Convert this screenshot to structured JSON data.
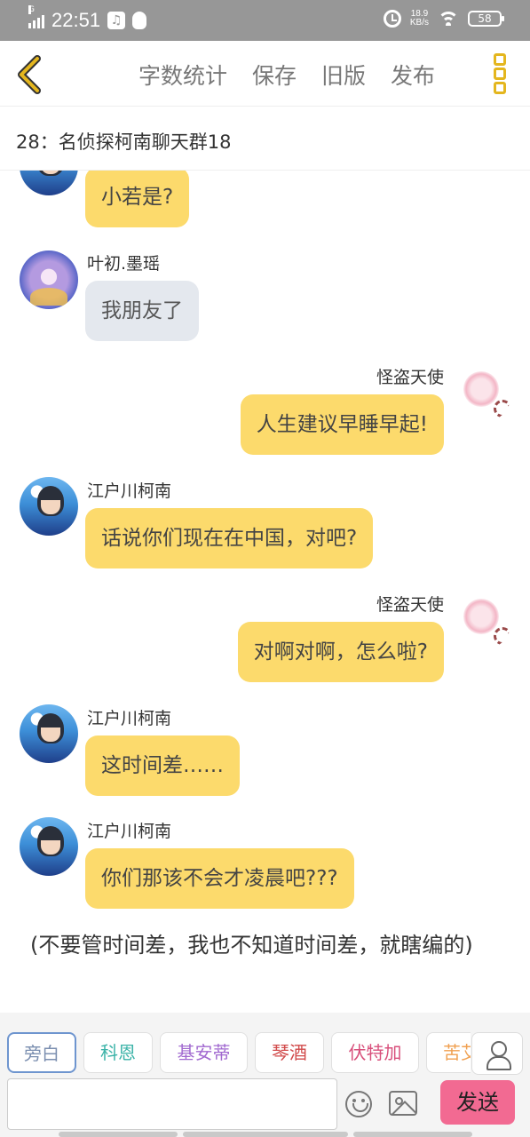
{
  "status_bar": {
    "network_type": "G",
    "time": "22:51",
    "speed_value": "18.9",
    "speed_unit": "KB/s",
    "battery": "58"
  },
  "toolbar": {
    "actions": [
      "字数统计",
      "保存",
      "旧版",
      "发布"
    ]
  },
  "chat_title": "28：名侦探柯南聊天群18",
  "messages": [
    {
      "side": "left",
      "name": "",
      "avatar": "conan-avatar",
      "text": "小若是?",
      "color": "yellow"
    },
    {
      "side": "left",
      "name": "叶初.墨瑶",
      "avatar": "ye-avatar",
      "text": "我朋友了",
      "color": "grey"
    },
    {
      "side": "right",
      "name": "怪盗天使",
      "avatar": "kid-avatar",
      "text": "人生建议早睡早起!",
      "color": "yellow"
    },
    {
      "side": "left",
      "name": "江户川柯南",
      "avatar": "conan-avatar",
      "text": "话说你们现在在中国，对吧?",
      "color": "yellow"
    },
    {
      "side": "right",
      "name": "怪盗天使",
      "avatar": "kid-avatar",
      "text": "对啊对啊，怎么啦?",
      "color": "yellow"
    },
    {
      "side": "left",
      "name": "江户川柯南",
      "avatar": "conan-avatar",
      "text": "这时间差……",
      "color": "yellow"
    },
    {
      "side": "left",
      "name": "江户川柯南",
      "avatar": "conan-avatar",
      "text": "你们那该不会才凌晨吧???",
      "color": "yellow"
    }
  ],
  "narration": "(不要管时间差，我也不知道时间差，就瞎编的)",
  "roles": [
    {
      "label": "旁白",
      "color": "#7b8fb0"
    },
    {
      "label": "科恩",
      "color": "#3bb3a8"
    },
    {
      "label": "基安蒂",
      "color": "#a26ad0"
    },
    {
      "label": "琴酒",
      "color": "#d14a4a"
    },
    {
      "label": "伏特加",
      "color": "#d8507c"
    },
    {
      "label": "苦艾",
      "color": "#f0a050"
    }
  ],
  "input": {
    "value": "",
    "placeholder": ""
  },
  "send_label": "发送",
  "colors": {
    "bubble_yellow": "#fcda6c",
    "bubble_grey": "#e4e8ee",
    "accent": "#e4b61e",
    "send": "#f26a92"
  }
}
